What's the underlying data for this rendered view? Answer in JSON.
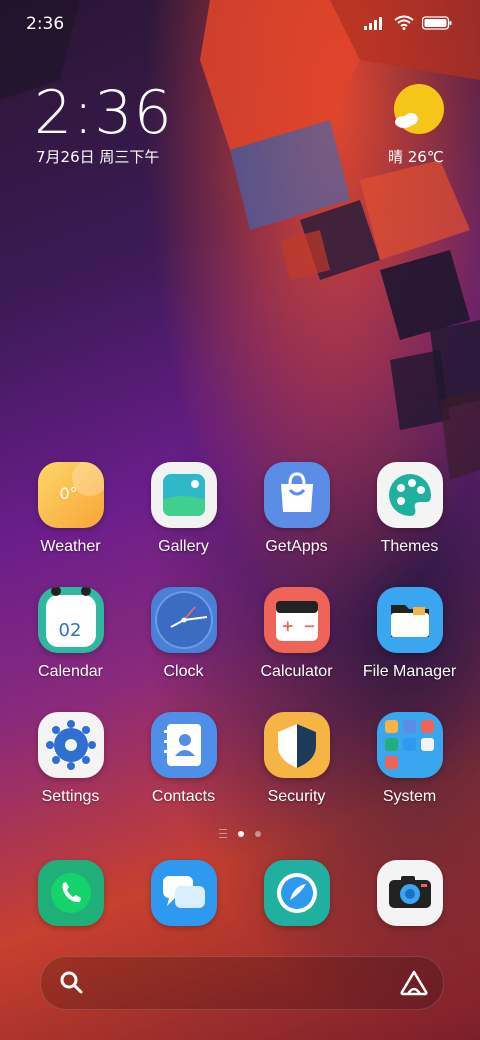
{
  "status_bar": {
    "time": "2:36",
    "icons": [
      "signal-icon",
      "wifi-icon",
      "battery-icon"
    ]
  },
  "clock_widget": {
    "time": "2:36",
    "date": "7月26日 周三下午"
  },
  "weather_widget": {
    "icon": "sunny-cloud-icon",
    "text": "晴 26℃"
  },
  "apps": [
    {
      "label": "Weather",
      "icon": "weather-app-icon",
      "icon_text": "0°"
    },
    {
      "label": "Gallery",
      "icon": "gallery-app-icon"
    },
    {
      "label": "GetApps",
      "icon": "getapps-app-icon"
    },
    {
      "label": "Themes",
      "icon": "themes-app-icon"
    },
    {
      "label": "Calendar",
      "icon": "calendar-app-icon",
      "icon_text": "02"
    },
    {
      "label": "Clock",
      "icon": "clock-app-icon"
    },
    {
      "label": "Calculator",
      "icon": "calculator-app-icon",
      "icon_text": "+ −"
    },
    {
      "label": "File Manager",
      "icon": "file-manager-app-icon"
    },
    {
      "label": "Settings",
      "icon": "settings-app-icon"
    },
    {
      "label": "Contacts",
      "icon": "contacts-app-icon"
    },
    {
      "label": "Security",
      "icon": "security-app-icon"
    },
    {
      "label": "System",
      "icon": "system-folder-icon"
    }
  ],
  "page_indicator": {
    "pages": 2,
    "active": 1
  },
  "dock": [
    {
      "name": "phone",
      "icon": "phone-icon"
    },
    {
      "name": "messages",
      "icon": "messages-icon"
    },
    {
      "name": "browser",
      "icon": "browser-icon"
    },
    {
      "name": "camera",
      "icon": "camera-icon"
    }
  ],
  "search_bar": {
    "left_icon": "search-icon",
    "right_icon": "assistant-icon"
  },
  "colors": {
    "weather": "#f6b445",
    "gallery": "#f2f2f2",
    "getapps": "#5b8de6",
    "themes": "#f4f4f4",
    "calendar": "#2fb8a0",
    "clock": "#4a7fd6",
    "calculator": "#ef6458",
    "file_manager": "#3aa6f0",
    "settings": "#f4f4f4",
    "contacts": "#4f8fe8",
    "security": "#f6b445",
    "phone": "#1fb07a",
    "messages": "#2d9af0",
    "browser": "#1fb0a0",
    "camera": "#f4f4f4"
  }
}
